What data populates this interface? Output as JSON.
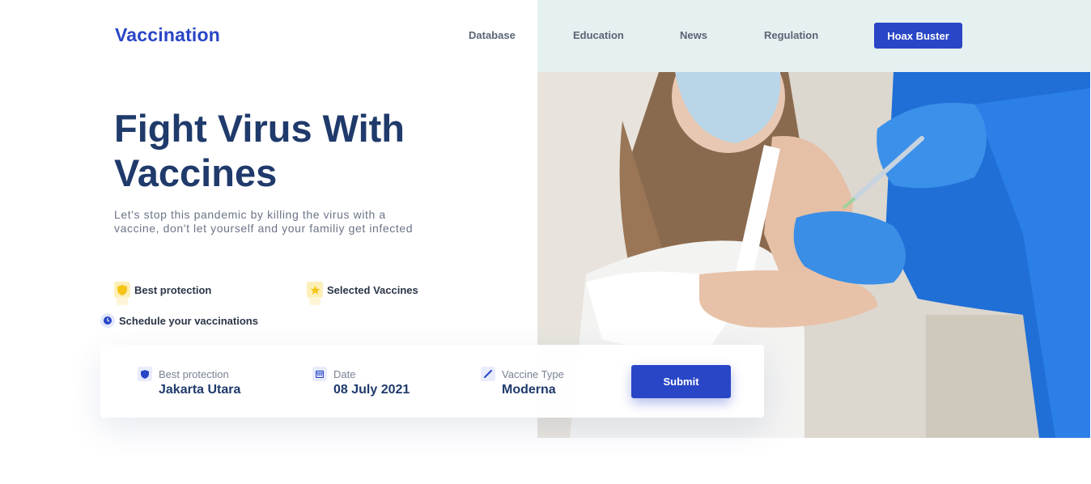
{
  "brand": {
    "logo": "Vaccination"
  },
  "nav": {
    "database": "Database",
    "education": "Education",
    "news": "News",
    "regulation": "Regulation",
    "cta": "Hoax Buster"
  },
  "hero": {
    "title": "Fight Virus With Vaccines",
    "description": "Let's stop this pandemic by killing the virus with a vaccine, don't let yourself and your familiy get infected"
  },
  "features": [
    {
      "label": "Best protection",
      "icon": "shield-icon"
    },
    {
      "label": "Selected Vaccines",
      "icon": "star-icon"
    },
    {
      "label": "Schedule your vaccinations",
      "icon": "clock-icon"
    }
  ],
  "booking": {
    "location_label": "Best protection",
    "location_value": "Jakarta Utara",
    "date_label": "Date",
    "date_value": "08 July 2021",
    "vaccine_label": "Vaccine Type",
    "vaccine_value": "Moderna",
    "submit": "Submit"
  },
  "colors": {
    "accent": "#2946c6",
    "heading": "#1f3a6b",
    "panel": "#e5f0f0"
  }
}
